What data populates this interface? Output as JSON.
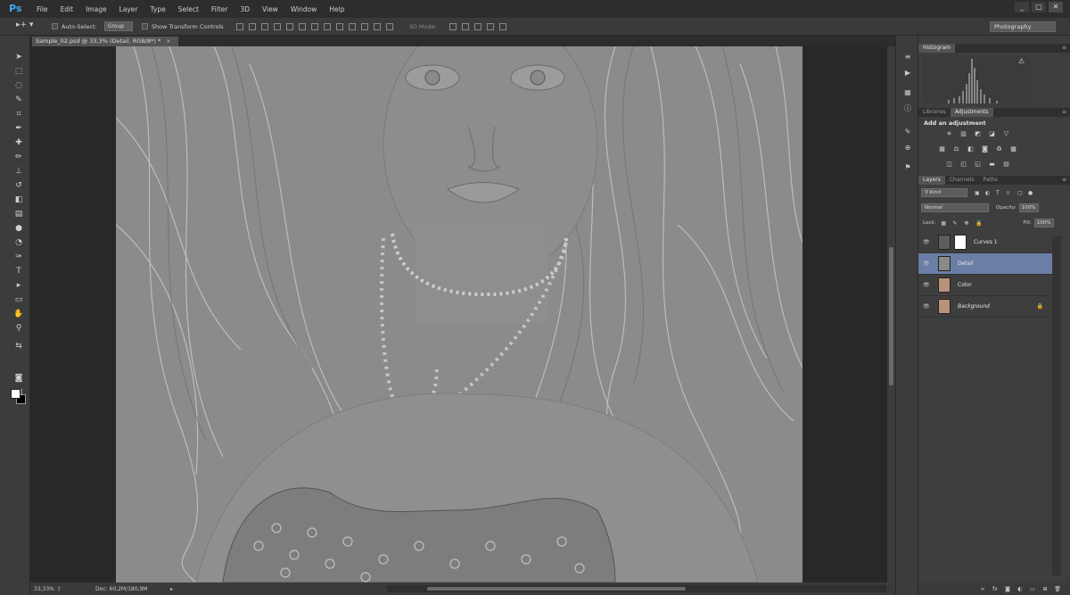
{
  "app": {
    "logo": "Ps",
    "menus": [
      "File",
      "Edit",
      "Image",
      "Layer",
      "Type",
      "Select",
      "Filter",
      "3D",
      "View",
      "Window",
      "Help"
    ],
    "window_controls": [
      "_",
      "□",
      "✕"
    ]
  },
  "options": {
    "auto_select_label": "Auto-Select:",
    "auto_select_value": "Group",
    "transform_label": "Show Transform Controls",
    "mode_3d_label": "3D Mode:",
    "workspace": "Photography"
  },
  "document": {
    "tab_title": "Sample_02.psd @ 33,3% (Detail, RGB/8*) *",
    "close": "×",
    "zoom": "33,33%",
    "doc_info": "Doc: 60,2M/180,9M"
  },
  "panels": {
    "histogram_tab": "Histogram",
    "libraries_tab": "Libraries",
    "adjustments_tab": "Adjustments",
    "add_adjustment": "Add an adjustment",
    "layers_tab": "Layers",
    "channels_tab": "Channels",
    "paths_tab": "Paths",
    "kind": "Kind",
    "blend_mode": "Normal",
    "opacity_label": "Opacity:",
    "opacity_value": "100%",
    "lock_label": "Lock:",
    "fill_label": "Fill:",
    "fill_value": "100%"
  },
  "layers": [
    {
      "name": "Curves 1",
      "selected": false,
      "italic": false,
      "locked": false
    },
    {
      "name": "Detail",
      "selected": true,
      "italic": false,
      "locked": false
    },
    {
      "name": "Color",
      "selected": false,
      "italic": false,
      "locked": false
    },
    {
      "name": "Background",
      "selected": false,
      "italic": true,
      "locked": true
    }
  ],
  "colors": {
    "selection": "#6b7fa6",
    "canvas_bg": "#282828",
    "panel_bg": "#3e3e3e"
  }
}
